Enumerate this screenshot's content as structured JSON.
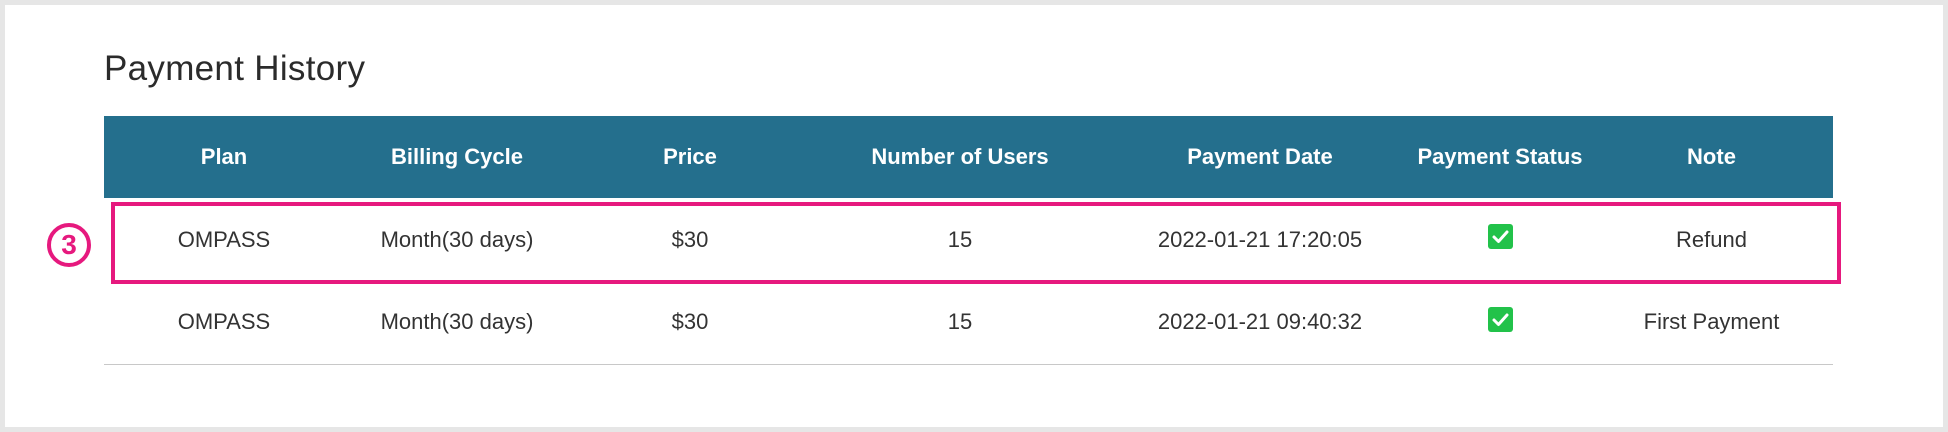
{
  "page": {
    "title": "Payment History"
  },
  "annotation": {
    "marker_label": "3",
    "highlight_color": "#e6197e"
  },
  "table": {
    "headers": [
      "Plan",
      "Billing Cycle",
      "Price",
      "Number of Users",
      "Payment Date",
      "Payment Status",
      "Note"
    ],
    "header_color": "#246f8d",
    "rows": [
      {
        "plan": "OMPASS",
        "billing_cycle": "Month(30 days)",
        "price": "$30",
        "users": "15",
        "payment_date": "2022-01-21 17:20:05",
        "payment_status": "checked",
        "note": "Refund"
      },
      {
        "plan": "OMPASS",
        "billing_cycle": "Month(30 days)",
        "price": "$30",
        "users": "15",
        "payment_date": "2022-01-21 09:40:32",
        "payment_status": "checked",
        "note": "First Payment"
      }
    ]
  },
  "icons": {
    "status_check": "checkbox-checked-icon",
    "status_color": "#22c24a"
  }
}
